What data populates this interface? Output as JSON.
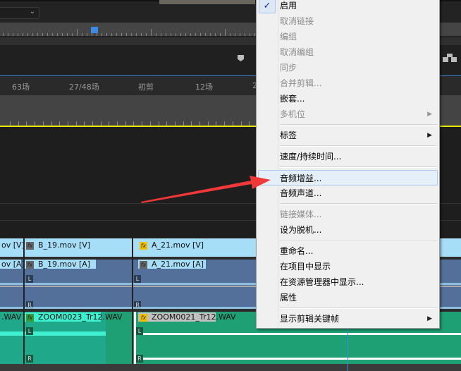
{
  "timeline": {
    "markers": [
      "63场",
      "27/48场",
      "初剪",
      "12场",
      "2"
    ],
    "tracks": {
      "video": [
        {
          "name": "ov [V]",
          "fx": "none"
        },
        {
          "name": "B_19.mov [V]",
          "fx": "grey"
        },
        {
          "name": "A_21.mov [V]",
          "fx": "yellow"
        }
      ],
      "audio": [
        {
          "name": "ov [A]",
          "fx": "none"
        },
        {
          "name": "B_19.mov [A]",
          "fx": "grey"
        },
        {
          "name": "A_21.mov [A]",
          "fx": "grey"
        }
      ],
      "wav": [
        {
          "name": ".WAV",
          "fx": "none"
        },
        {
          "name": "ZOOM0023_Tr12.WAV",
          "fx": "green"
        },
        {
          "name": "ZOOM0021_Tr12.WAV",
          "fx": "yellow"
        }
      ],
      "channel_left": "L",
      "channel_right": "R",
      "fx_label": "fx"
    }
  },
  "context_menu": {
    "check_mark": "✓",
    "submenu_arrow": "▶",
    "items": [
      {
        "label": "启用",
        "checked": true
      },
      {
        "label": "取消链接",
        "disabled": true
      },
      {
        "label": "编组",
        "disabled": true
      },
      {
        "label": "取消编组",
        "disabled": true
      },
      {
        "label": "同步",
        "disabled": true
      },
      {
        "label": "合并剪辑...",
        "disabled": true
      },
      {
        "label": "嵌套..."
      },
      {
        "label": "多机位",
        "disabled": true,
        "submenu": true
      },
      {
        "separator": true
      },
      {
        "label": "标签",
        "submenu": true
      },
      {
        "separator": true
      },
      {
        "label": "速度/持续时间..."
      },
      {
        "separator": true
      },
      {
        "label": "音频增益...",
        "highlighted": true
      },
      {
        "label": "音频声道..."
      },
      {
        "separator": true
      },
      {
        "label": "链接媒体...",
        "disabled": true
      },
      {
        "label": "设为脱机..."
      },
      {
        "separator": true
      },
      {
        "label": "重命名..."
      },
      {
        "label": "在项目中显示"
      },
      {
        "label": "在资源管理器中显示..."
      },
      {
        "label": "属性"
      },
      {
        "separator": true
      },
      {
        "label": "显示剪辑关键帧",
        "submenu": true
      }
    ]
  },
  "colors": {
    "accent": "#3a8ce8",
    "annotation_arrow": "#f03838",
    "playhead_line": "#e8e800"
  }
}
